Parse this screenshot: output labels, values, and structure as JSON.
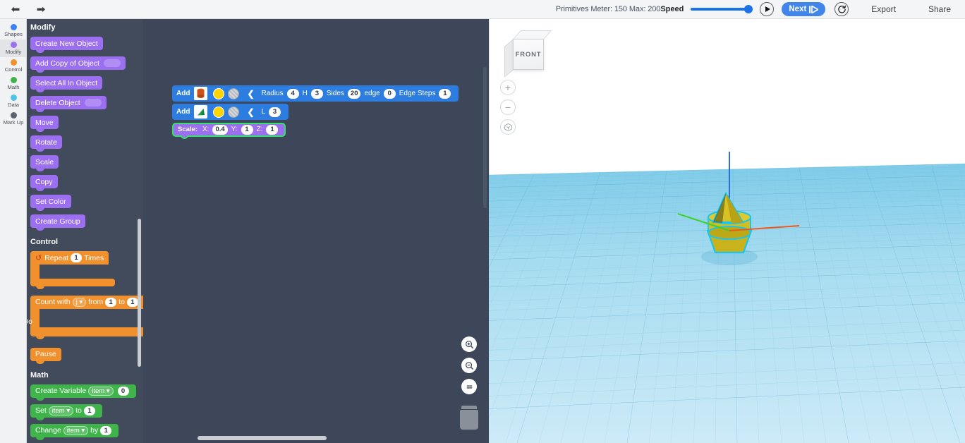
{
  "topbar": {
    "undo_icon": "undo-arrow-icon",
    "redo_icon": "redo-arrow-icon",
    "meter_text": "Primitives Meter: 150 Max: 200",
    "speed_label": "Speed",
    "speed_value": 100,
    "play_label": "play",
    "next_label": "Next",
    "reset_label": "reset",
    "export_label": "Export",
    "share_label": "Share"
  },
  "rail": {
    "items": [
      {
        "label": "Shapes",
        "color": "#3b82f6",
        "active": false
      },
      {
        "label": "Modify",
        "color": "#9b6ff0",
        "active": true
      },
      {
        "label": "Control",
        "color": "#f0912d",
        "active": false
      },
      {
        "label": "Math",
        "color": "#3fb44b",
        "active": false
      },
      {
        "label": "Data",
        "color": "#4fc3e8",
        "active": false
      },
      {
        "label": "Mark Up",
        "color": "#5b6473",
        "active": false
      }
    ]
  },
  "palette": {
    "sections": [
      {
        "heading": "Modify",
        "blocks": [
          {
            "label": "Create New Object",
            "knob": false
          },
          {
            "label": "Add Copy of Object",
            "knob": true
          },
          {
            "label": "Select All In Object",
            "knob": false
          },
          {
            "label": "Delete Object",
            "knob": true
          },
          {
            "label": "Move",
            "knob": false
          },
          {
            "label": "Rotate",
            "knob": false
          },
          {
            "label": "Scale",
            "knob": false
          },
          {
            "label": "Copy",
            "knob": false
          },
          {
            "label": "Set Color",
            "knob": false
          },
          {
            "label": "Create Group",
            "knob": false
          }
        ]
      },
      {
        "heading": "Control",
        "repeat": {
          "prefix": "Repeat",
          "count": "1",
          "suffix": "Times"
        },
        "count_with": {
          "prefix": "Count with",
          "var": "j",
          "from_label": "from",
          "from": "1",
          "to_label": "to",
          "to": "1",
          "do_label": "Do"
        },
        "pause": {
          "label": "Pause"
        }
      },
      {
        "heading": "Math",
        "create_variable": {
          "label": "Create Variable",
          "var": "item",
          "value": "0"
        },
        "set": {
          "label": "Set",
          "var": "item",
          "to_label": "to",
          "value": "1"
        },
        "change": {
          "label": "Change",
          "var": "item",
          "by_label": "by",
          "value": "1"
        }
      }
    ]
  },
  "workspace": {
    "blocks": [
      {
        "label": "Add",
        "shape": "cylinder",
        "fields": [
          {
            "name": "Radius",
            "value": "4"
          },
          {
            "name": "H",
            "value": "3"
          },
          {
            "name": "Sides",
            "value": "20"
          },
          {
            "name": "edge",
            "value": "0"
          },
          {
            "name": "Edge Steps",
            "value": "1"
          }
        ]
      },
      {
        "label": "Add",
        "shape": "cone",
        "fields": [
          {
            "name": "L",
            "value": "3"
          }
        ]
      }
    ],
    "scale_block": {
      "label": "Scale:",
      "axes": [
        {
          "name": "X:",
          "value": "0.4"
        },
        {
          "name": "Y:",
          "value": "1"
        },
        {
          "name": "Z:",
          "value": "1"
        }
      ]
    },
    "tools": [
      {
        "name": "zoom-in-icon"
      },
      {
        "name": "zoom-out-icon"
      },
      {
        "name": "center-icon"
      },
      {
        "name": "trash-icon"
      }
    ]
  },
  "viewport": {
    "viewcube_face": "FRONT",
    "zoom_in": "+",
    "zoom_out": "−",
    "home": "home-cube-icon"
  }
}
